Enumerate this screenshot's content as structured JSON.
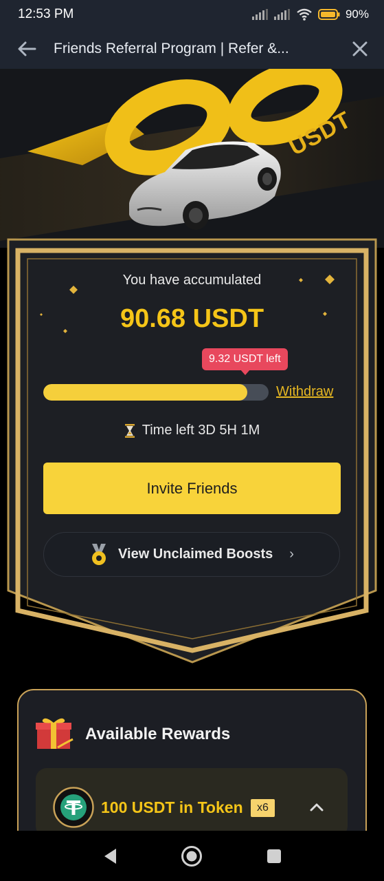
{
  "status_bar": {
    "time": "12:53 PM",
    "battery": "90"
  },
  "header": {
    "title": "Friends Referral Program | Refer &...",
    "back_icon": "arrow-left-icon",
    "close_icon": "close-icon"
  },
  "hero": {
    "big_number": "100",
    "unit": "USDT"
  },
  "accumulated": {
    "label": "You have accumulated",
    "value": "90.68 USDT",
    "left_badge": "9.32 USDT left",
    "progress": 0.9068,
    "withdraw_label": "Withdraw",
    "time_left": "Time left 3D 5H 1M"
  },
  "actions": {
    "invite_label": "Invite Friends",
    "boosts_label": "View Unclaimed Boosts"
  },
  "rewards": {
    "title": "Available Rewards",
    "item_label": "100 USDT in Token",
    "item_multiplier": "x6"
  },
  "colors": {
    "accent": "#f5c518",
    "button": "#f8d33a",
    "badge": "#e8485d",
    "gold_frame": "#c9a258"
  }
}
